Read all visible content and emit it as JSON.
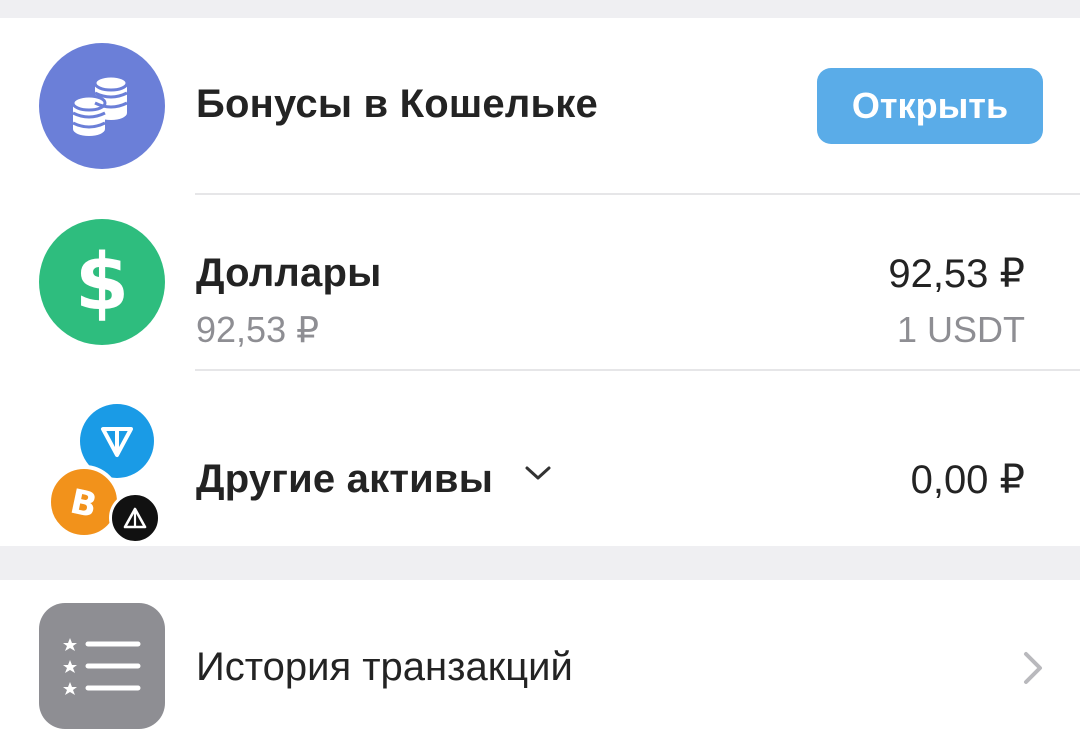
{
  "bonus_row": {
    "title": "Бонусы в Кошельке",
    "button_label": "Открыть",
    "icon": "coins-icon",
    "icon_color": "#6b7fd8"
  },
  "dollars_row": {
    "title": "Доллары",
    "subtitle": "92,53 ₽",
    "amount": "92,53 ₽",
    "amount_sub": "1 USDT",
    "icon": "dollar-icon",
    "icon_color": "#2ebd7e"
  },
  "other_assets_row": {
    "title": "Другие активы",
    "amount": "0,00 ₽",
    "icons": [
      "ton-icon",
      "bitcoin-icon",
      "tron-icon"
    ],
    "chevron": "chevron-down-icon"
  },
  "history_row": {
    "title": "История транзакций",
    "icon": "list-icon",
    "chevron": "chevron-right-icon"
  },
  "colors": {
    "accent_button": "#5aace8",
    "background": "#efeff2",
    "card": "#ffffff",
    "secondary_text": "#8e8e93"
  }
}
